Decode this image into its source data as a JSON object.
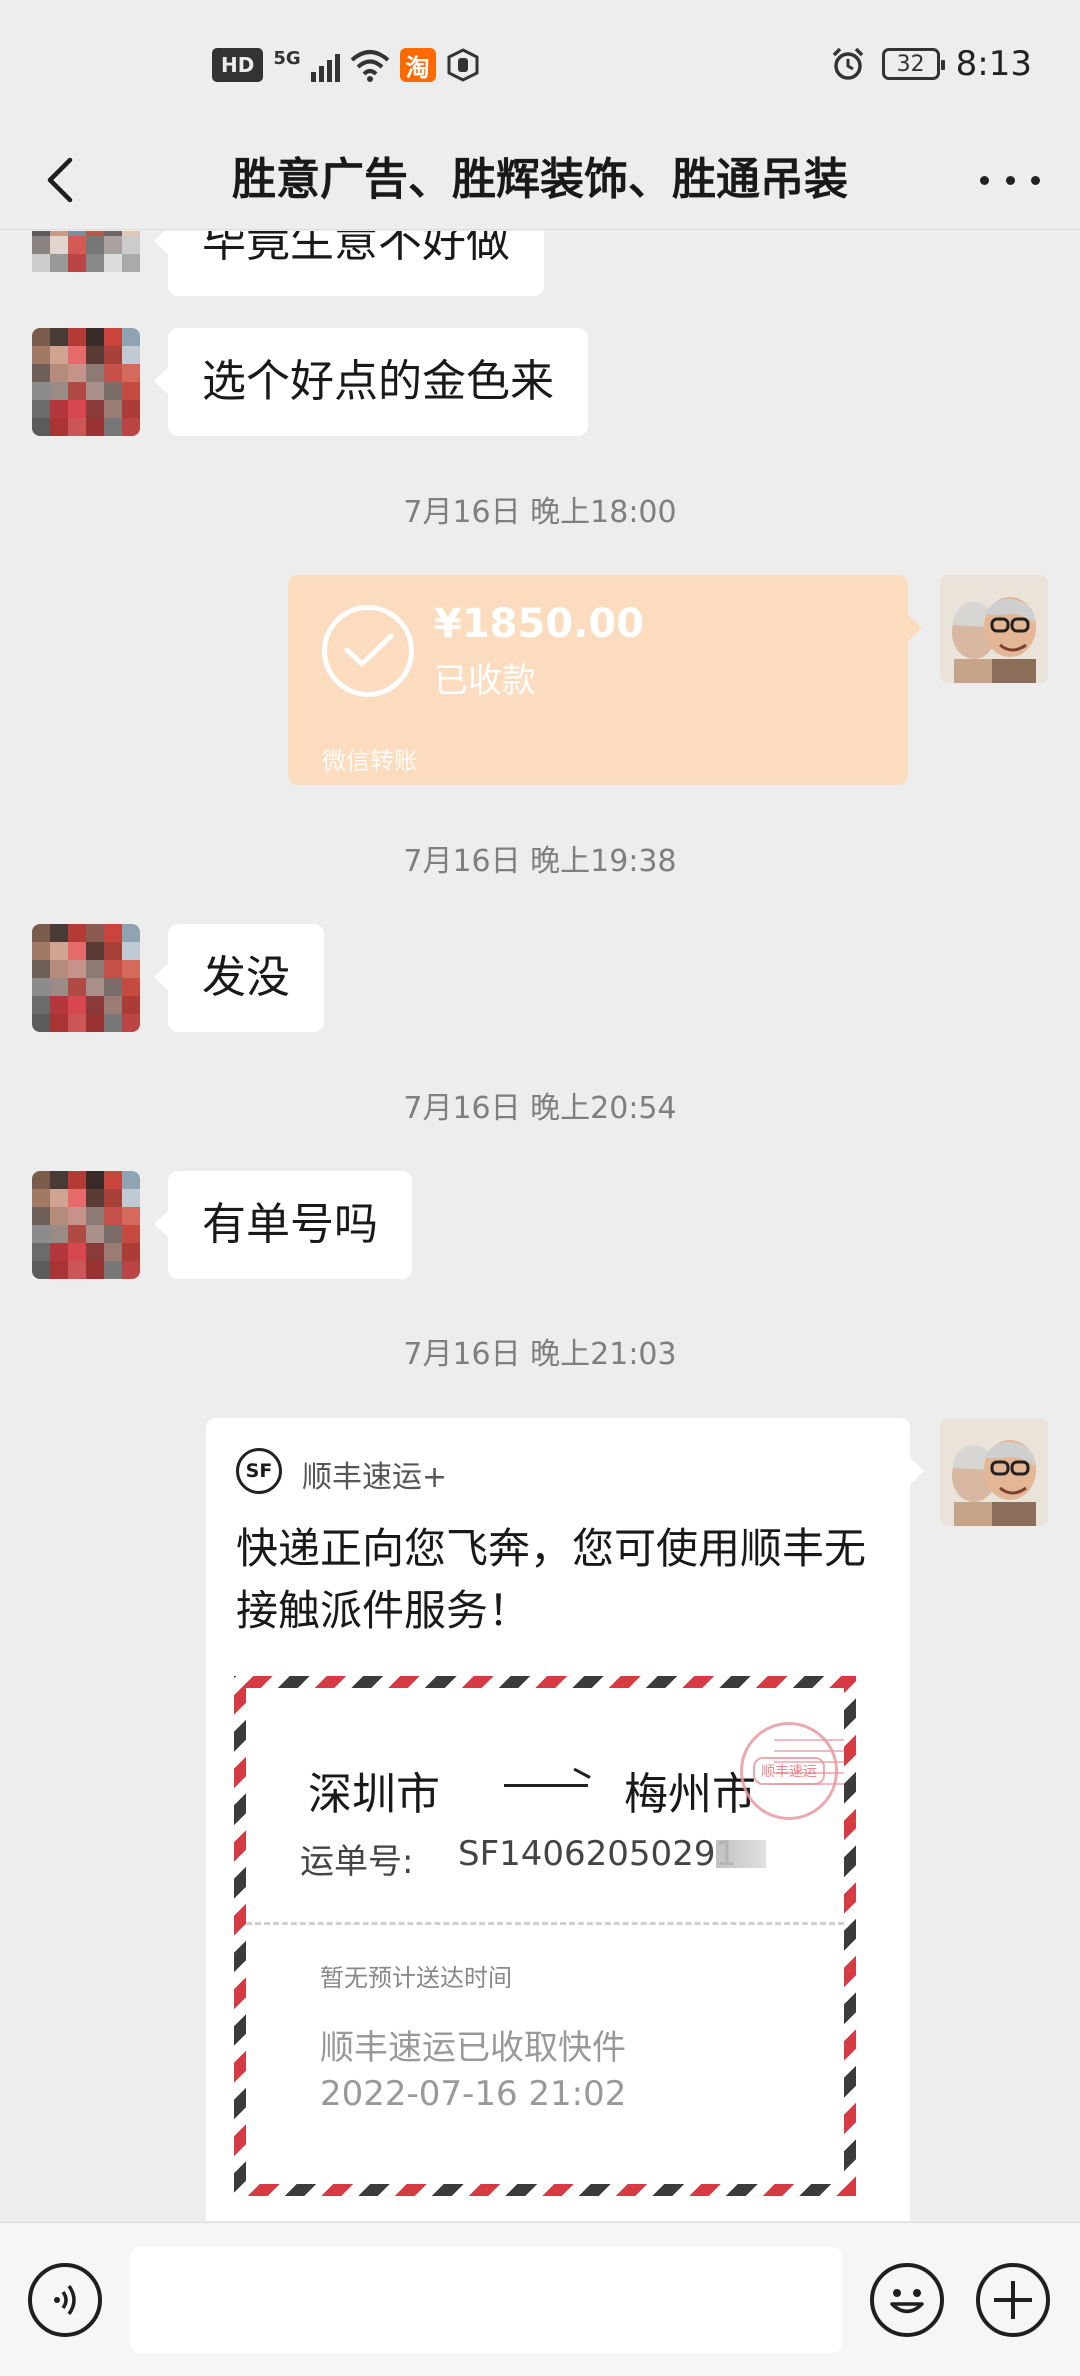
{
  "status_bar": {
    "hd_badge": "HD",
    "network": "5G",
    "taobao_icon": "淘",
    "battery": "32",
    "time": "8:13"
  },
  "header": {
    "title": "胜意广告、胜辉装饰、胜通吊装"
  },
  "messages": {
    "partial_text": "毕竟生意不好做",
    "msg1": "选个好点的金色来",
    "time1": "7月16日 晚上18:00",
    "transfer": {
      "amount": "¥1850.00",
      "status": "已收款",
      "footer": "微信转账",
      "color": "#fcdcbe"
    },
    "time2": "7月16日 晚上19:38",
    "msg2": "发没",
    "time3": "7月16日 晚上20:54",
    "msg3": "有单号吗",
    "time4": "7月16日 晚上21:03",
    "shipment": {
      "logo": "SF",
      "service": "顺丰速运+",
      "message": "快递正向您飞奔，您可使用顺丰无接触派件服务！",
      "origin": "深圳市",
      "destination": "梅州市",
      "waybill_label": "运单号:",
      "waybill_number": "SF14062050291",
      "stamp": "顺丰速运",
      "eta": "暂无预计送达时间",
      "status": "顺丰速运已收取快件",
      "date": "2022-07-16 21:02"
    }
  },
  "input_bar": {
    "icons": [
      "voice-icon",
      "emoji-icon",
      "plus-icon"
    ]
  }
}
